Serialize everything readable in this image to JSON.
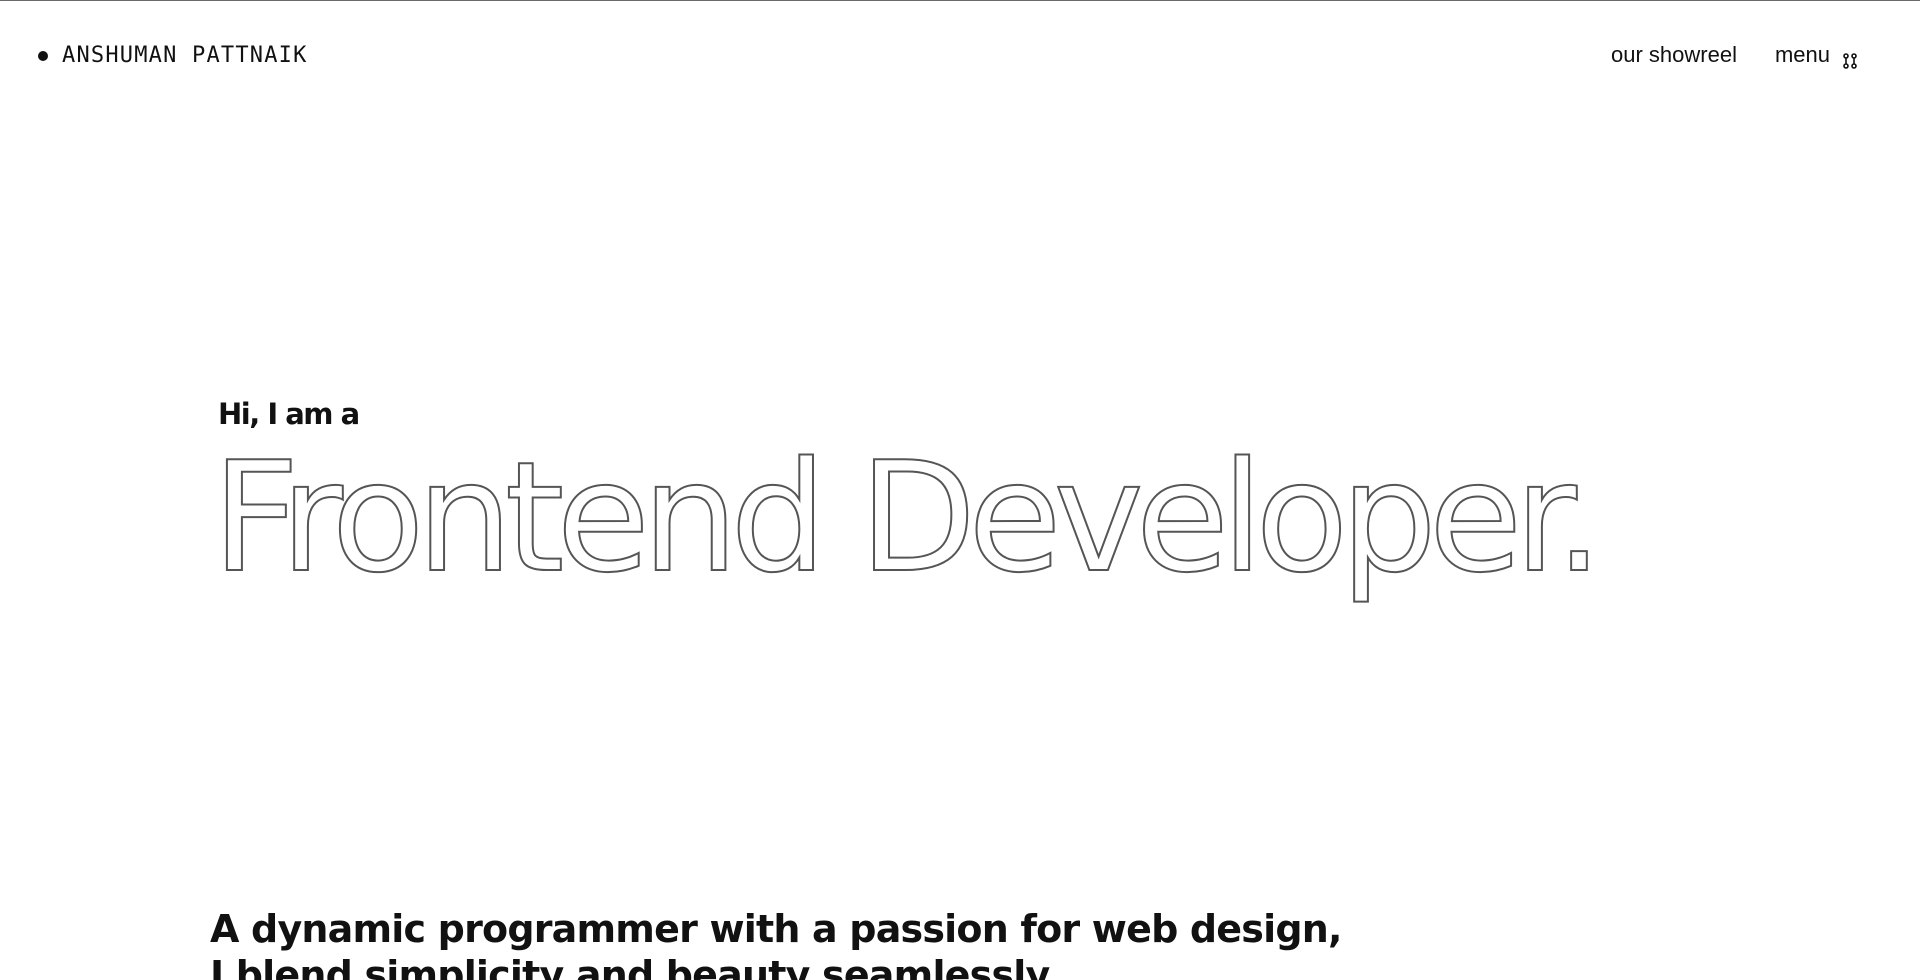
{
  "header": {
    "brand_name": "ANSHUMAN PATTNAIK",
    "nav": {
      "showreel_label": "our showreel",
      "menu_label": "menu"
    }
  },
  "hero": {
    "intro": "Hi, I am a",
    "title": "Frontend Developer."
  },
  "about": {
    "line_1": "A dynamic programmer with a passion for web design,",
    "line_2": "I blend simplicity and beauty seamlessly."
  },
  "icons": {
    "brand_dot": "dot-icon",
    "menu_icon": "grid-dots-icon"
  },
  "colors": {
    "background": "#ffffff",
    "text": "#111111",
    "outline_stroke": "#555555"
  }
}
